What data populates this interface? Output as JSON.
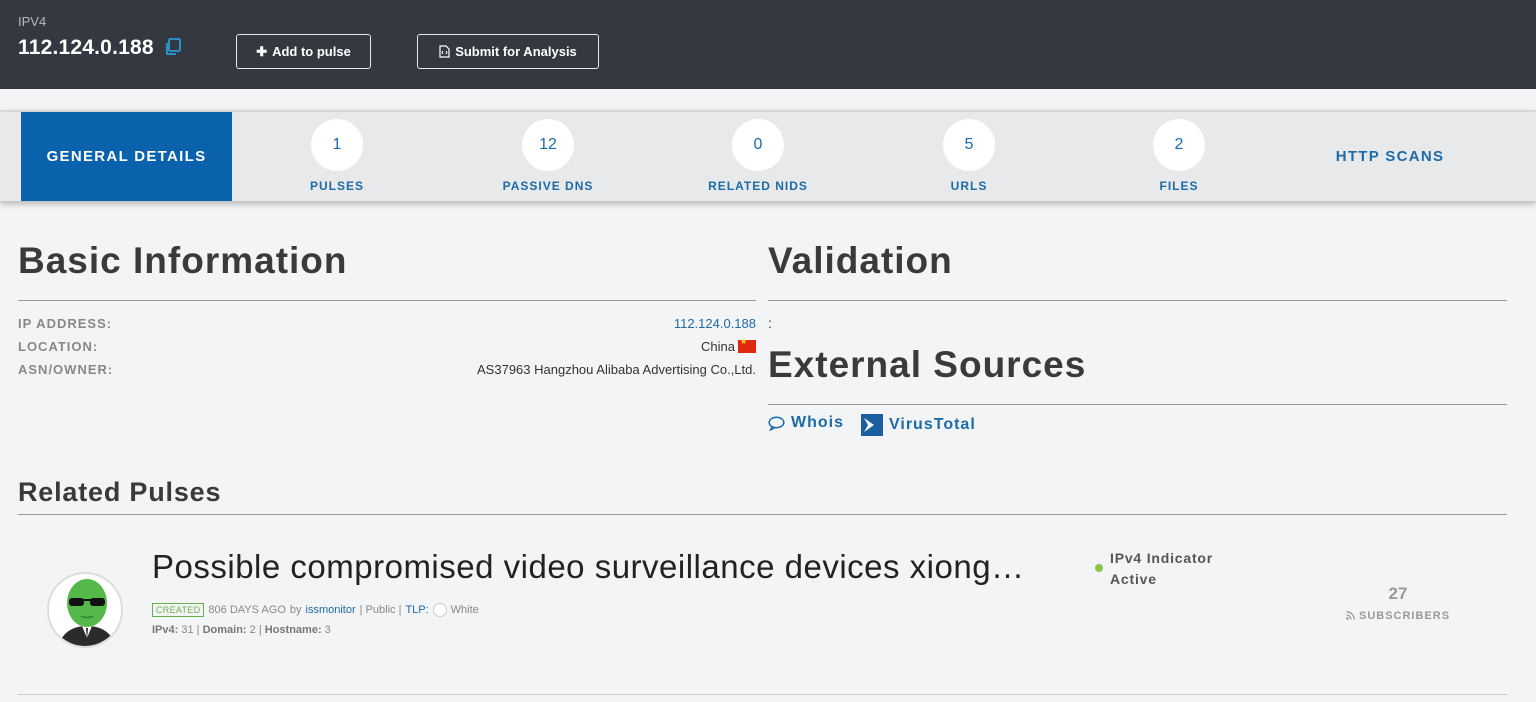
{
  "header": {
    "indicator_type": "IPV4",
    "indicator_value": "112.124.0.188",
    "add_to_pulse_label": "Add to pulse",
    "submit_analysis_label": "Submit for Analysis"
  },
  "tabs": {
    "active_label": "GENERAL DETAILS",
    "items": [
      {
        "count": "1",
        "label": "PULSES"
      },
      {
        "count": "12",
        "label": "PASSIVE DNS"
      },
      {
        "count": "0",
        "label": "RELATED NIDS"
      },
      {
        "count": "5",
        "label": "URLS"
      },
      {
        "count": "2",
        "label": "FILES"
      }
    ],
    "http_scans_label": "HTTP SCANS"
  },
  "basic_info": {
    "title": "Basic Information",
    "rows": [
      {
        "label": "IP ADDRESS:",
        "value": "112.124.0.188"
      },
      {
        "label": "LOCATION:",
        "value": "China"
      },
      {
        "label": "ASN/OWNER:",
        "value": "AS37963 Hangzhou Alibaba Advertising Co.,Ltd."
      }
    ]
  },
  "validation": {
    "title": "Validation",
    "value": ":"
  },
  "external_sources": {
    "title": "External Sources",
    "whois_label": "Whois",
    "virustotal_label": "VirusTotal"
  },
  "related_pulses": {
    "title": "Related Pulses",
    "pulse": {
      "title": "Possible compromised video surveillance devices xiong…",
      "created_badge": "CREATED",
      "age": "806 DAYS AGO",
      "by_label": "by",
      "author": "issmonitor",
      "visibility": "| Public |",
      "tlp_label": "TLP:",
      "tlp_value": "White",
      "counts_ipv4_label": "IPv4:",
      "counts_ipv4_value": "31",
      "counts_domain_label": "Domain:",
      "counts_domain_value": "2",
      "counts_hostname_label": "Hostname:",
      "counts_hostname_value": "3",
      "status_line1": "IPv4 Indicator",
      "status_line2": "Active",
      "subscribers_count": "27",
      "subscribers_label": "SUBSCRIBERS"
    }
  }
}
